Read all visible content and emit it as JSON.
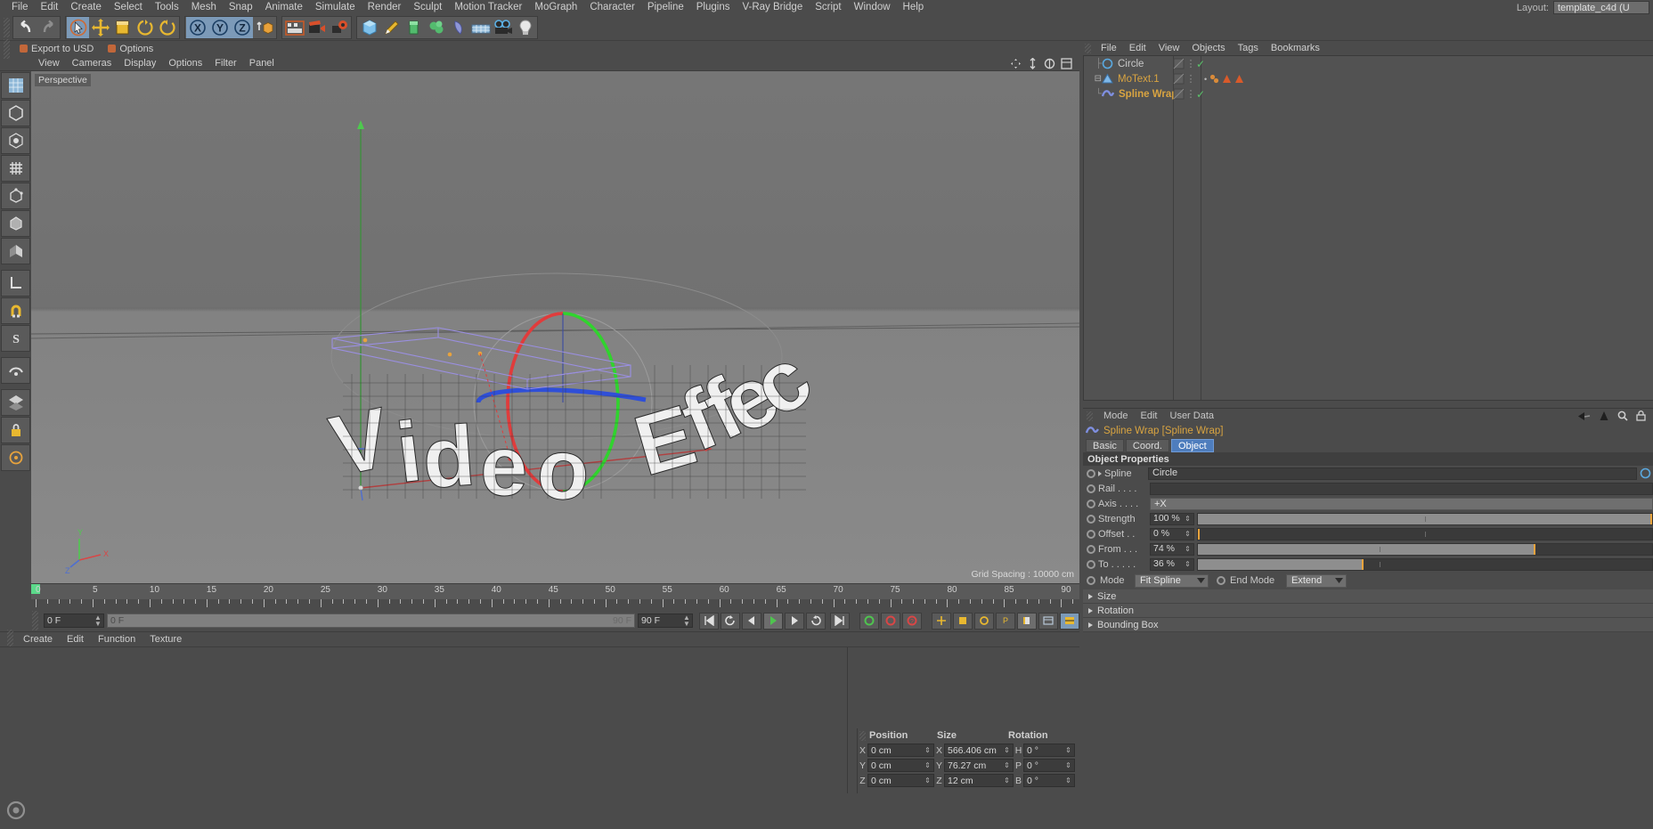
{
  "app": {
    "menu": [
      "File",
      "Edit",
      "Create",
      "Select",
      "Tools",
      "Mesh",
      "Snap",
      "Animate",
      "Simulate",
      "Render",
      "Sculpt",
      "Motion Tracker",
      "MoGraph",
      "Character",
      "Pipeline",
      "Plugins",
      "V-Ray Bridge",
      "Script",
      "Window",
      "Help"
    ],
    "layout_label": "Layout:",
    "layout_value": "template_c4d (U"
  },
  "secondary_toolbar": {
    "export_usd": "Export to USD",
    "options": "Options"
  },
  "viewport": {
    "menu": [
      "View",
      "Cameras",
      "Display",
      "Options",
      "Filter",
      "Panel"
    ],
    "label": "Perspective",
    "grid_spacing": "Grid Spacing : 10000 cm",
    "scene_text": "Video Effect"
  },
  "timeline": {
    "ticks": [
      "0",
      "5",
      "10",
      "15",
      "20",
      "25",
      "30",
      "35",
      "40",
      "45",
      "50",
      "55",
      "60",
      "65",
      "70",
      "75",
      "80",
      "85",
      "90"
    ],
    "current_frame": "0 F",
    "range_start": "0 F",
    "range_end": "90 F",
    "preview_end": "90 F",
    "end_field": "90 F"
  },
  "bottom_menu": [
    "Create",
    "Edit",
    "Function",
    "Texture"
  ],
  "coords": {
    "headers": [
      "Position",
      "Size",
      "Rotation"
    ],
    "rows": [
      {
        "pos_axis": "X",
        "pos": "0 cm",
        "size_axis": "X",
        "size": "566.406 cm",
        "rot_axis": "H",
        "rot": "0 °"
      },
      {
        "pos_axis": "Y",
        "pos": "0 cm",
        "size_axis": "Y",
        "size": "76.27 cm",
        "rot_axis": "P",
        "rot": "0 °"
      },
      {
        "pos_axis": "Z",
        "pos": "0 cm",
        "size_axis": "Z",
        "size": "12 cm",
        "rot_axis": "B",
        "rot": "0 °"
      }
    ]
  },
  "object_manager": {
    "menu": [
      "File",
      "Edit",
      "View",
      "Objects",
      "Tags",
      "Bookmarks"
    ],
    "items": [
      {
        "name": "Circle",
        "color": "#c8c8c8",
        "indent": 0,
        "icon": "circle-spline-icon",
        "has_expander": false,
        "check": true
      },
      {
        "name": "MoText.1",
        "color": "#d9a441",
        "indent": 0,
        "icon": "motext-icon",
        "has_expander": true,
        "check": false
      },
      {
        "name": "Spline Wrap",
        "color": "#d9a441",
        "indent": 1,
        "icon": "spline-wrap-icon",
        "has_expander": false,
        "check": true
      }
    ]
  },
  "attribute_manager": {
    "menu": [
      "Mode",
      "Edit",
      "User Data"
    ],
    "title": "Spline Wrap [Spline Wrap]",
    "tabs": [
      {
        "label": "Basic",
        "selected": false
      },
      {
        "label": "Coord.",
        "selected": false
      },
      {
        "label": "Object",
        "selected": true
      }
    ],
    "section": "Object Properties",
    "properties": [
      {
        "label": "Spline",
        "type": "link",
        "value": "Circle",
        "expander": true
      },
      {
        "label": "Rail . . . .",
        "type": "link",
        "value": "",
        "expander": false
      },
      {
        "label": "Axis . . . .",
        "type": "combo",
        "value": "+X"
      },
      {
        "label": "Strength",
        "type": "slider",
        "value": "100 %",
        "fill": 100,
        "knob": 100
      },
      {
        "label": "Offset . .",
        "type": "slider",
        "value": "0 %",
        "fill": 0,
        "knob": 0
      },
      {
        "label": "From . . .",
        "type": "slider",
        "value": "74 %",
        "fill": 74,
        "knob": 74
      },
      {
        "label": "To . . . . .",
        "type": "slider",
        "value": "36 %",
        "fill": 36,
        "knob": 36
      }
    ],
    "mode_label": "Mode",
    "mode_value": "Fit Spline",
    "end_mode_label": "End Mode",
    "end_mode_value": "Extend",
    "folds": [
      "Size",
      "Rotation",
      "Bounding Box"
    ]
  },
  "colors": {
    "accent_orange": "#d9a441",
    "accent_blue": "#4e7dbd",
    "panel_bg": "#4b4b4b",
    "axis_x": "#d94646",
    "axis_y": "#4ec94e",
    "axis_z": "#4f6fd0"
  }
}
